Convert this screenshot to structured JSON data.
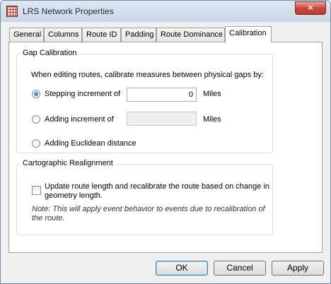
{
  "window": {
    "title": "LRS Network Properties",
    "close_glyph": "✕"
  },
  "tabs": [
    {
      "label": "General",
      "active": false
    },
    {
      "label": "Columns",
      "active": false
    },
    {
      "label": "Route ID",
      "active": false
    },
    {
      "label": "Padding",
      "active": false
    },
    {
      "label": "Route Dominance",
      "active": false
    },
    {
      "label": "Calibration",
      "active": true
    }
  ],
  "gap_calibration": {
    "legend": "Gap Calibration",
    "instruction": "When editing routes, calibrate measures between physical gaps by:",
    "options": [
      {
        "label": "Stepping increment of",
        "selected": true,
        "value": "0",
        "unit": "Miles"
      },
      {
        "label": "Adding increment of",
        "selected": false,
        "value": "",
        "unit": "Miles"
      },
      {
        "label": "Adding Euclidean distance",
        "selected": false
      }
    ]
  },
  "cartographic_realignment": {
    "legend": "Cartographic Realignment",
    "checkbox_label_line1": "Update route length and recalibrate the route based on change in",
    "checkbox_label_line2": "geometry length.",
    "checked": false,
    "note_line1": "Note: This will apply event behavior to events due to recalibration of",
    "note_line2": "the route."
  },
  "buttons": {
    "ok": "OK",
    "cancel": "Cancel",
    "apply": "Apply"
  },
  "colors": {
    "title_bar": "#c9d7e6",
    "close_button": "#c9483a",
    "radio_fill": "#1c5fab"
  }
}
